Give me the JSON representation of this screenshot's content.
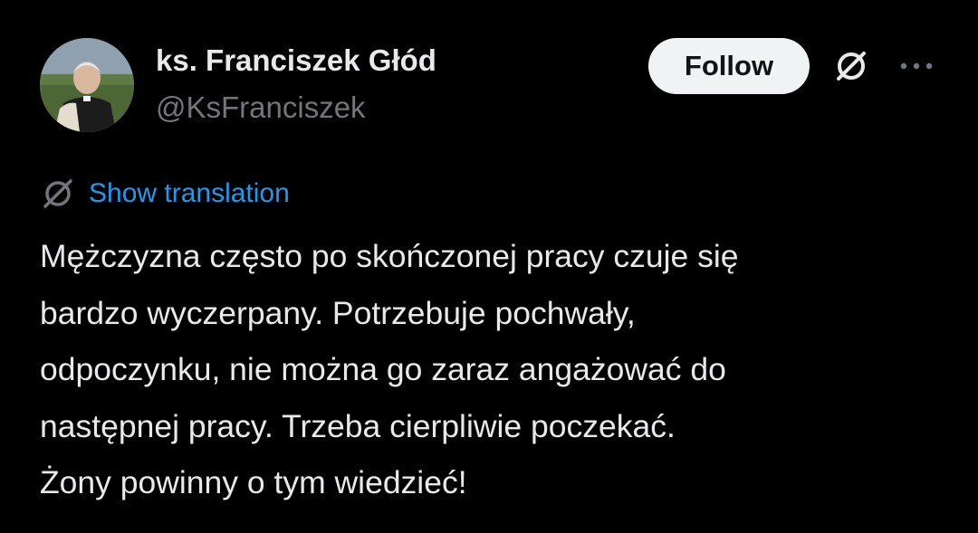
{
  "author": {
    "display_name": "ks. Franciszek Głód",
    "handle": "@KsFranciszek",
    "avatar_icon": "profile-photo"
  },
  "header_actions": {
    "follow_label": "Follow",
    "grok_icon": "grok-icon",
    "more_icon": "ellipsis-icon"
  },
  "translation": {
    "icon": "translate-icon",
    "label": "Show translation"
  },
  "tweet": {
    "lines": [
      "Mężczyzna często po skończonej pracy czuje się",
      "bardzo wyczerpany. Potrzebuje pochwały,",
      "odpoczynku, nie można go zaraz angażować do",
      "następnej pracy. Trzeba cierpliwie poczekać.",
      "Żony powinny o tym wiedzieć!"
    ]
  },
  "colors": {
    "background": "#000000",
    "text": "#e7e9ea",
    "secondary_text": "#71767b",
    "link": "#1d9bf0",
    "button_bg": "#eff3f4",
    "button_text": "#0f1419"
  }
}
